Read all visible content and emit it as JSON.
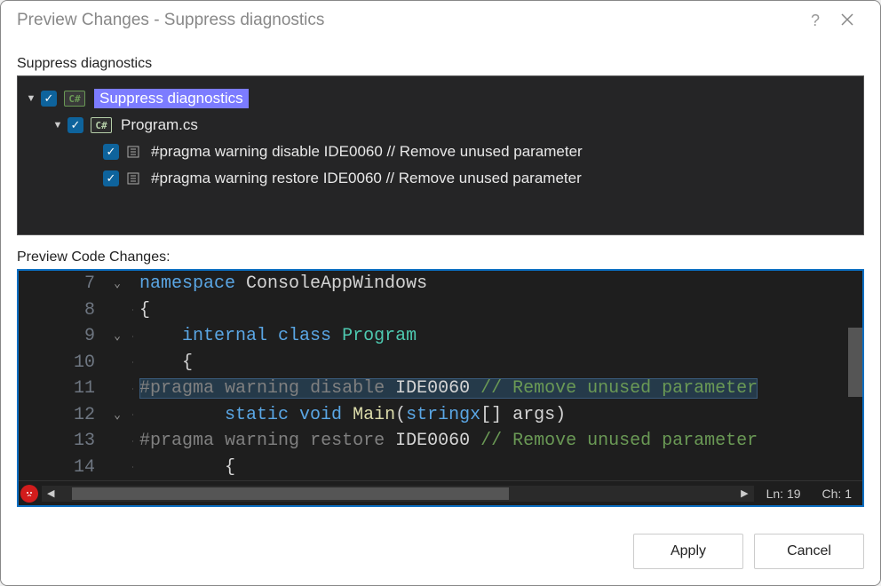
{
  "dialog": {
    "title": "Preview Changes - Suppress diagnostics"
  },
  "tree": {
    "label": "Suppress diagnostics",
    "root": {
      "label": "Suppress diagnostics",
      "children": [
        {
          "label": "Program.cs",
          "children": [
            {
              "label": "#pragma warning disable IDE0060 // Remove unused parameter"
            },
            {
              "label": "#pragma warning restore IDE0060 // Remove unused parameter"
            }
          ]
        }
      ]
    }
  },
  "preview": {
    "label": "Preview Code Changes:",
    "status": {
      "ln": "Ln: 19",
      "ch": "Ch: 1"
    },
    "lines": [
      {
        "num": "7",
        "kw": "namespace",
        "rest": " ConsoleAppWindows"
      },
      {
        "num": "8",
        "text": "{"
      },
      {
        "num": "9",
        "kw1": "internal",
        "kw2": "class",
        "cls": "Program"
      },
      {
        "num": "10",
        "text": "{"
      },
      {
        "num": "11",
        "pragma1": "#pragma",
        "pragma2": "warning",
        "pragma3": "disable",
        "code": "IDE0060",
        "comment": "// Remove unused parameter"
      },
      {
        "num": "12",
        "kw1": "static",
        "kw2": "void",
        "fn": "Main",
        "sig1": "(",
        "type": "stringx",
        "sig2": "[] ",
        "arg": "args",
        "sig3": ")"
      },
      {
        "num": "13",
        "pragma1": "#pragma",
        "pragma2": "warning",
        "pragma3": "restore",
        "code": "IDE0060",
        "comment": "// Remove unused parameter"
      },
      {
        "num": "14",
        "text": "{"
      }
    ]
  },
  "buttons": {
    "apply": "Apply",
    "cancel": "Cancel"
  }
}
